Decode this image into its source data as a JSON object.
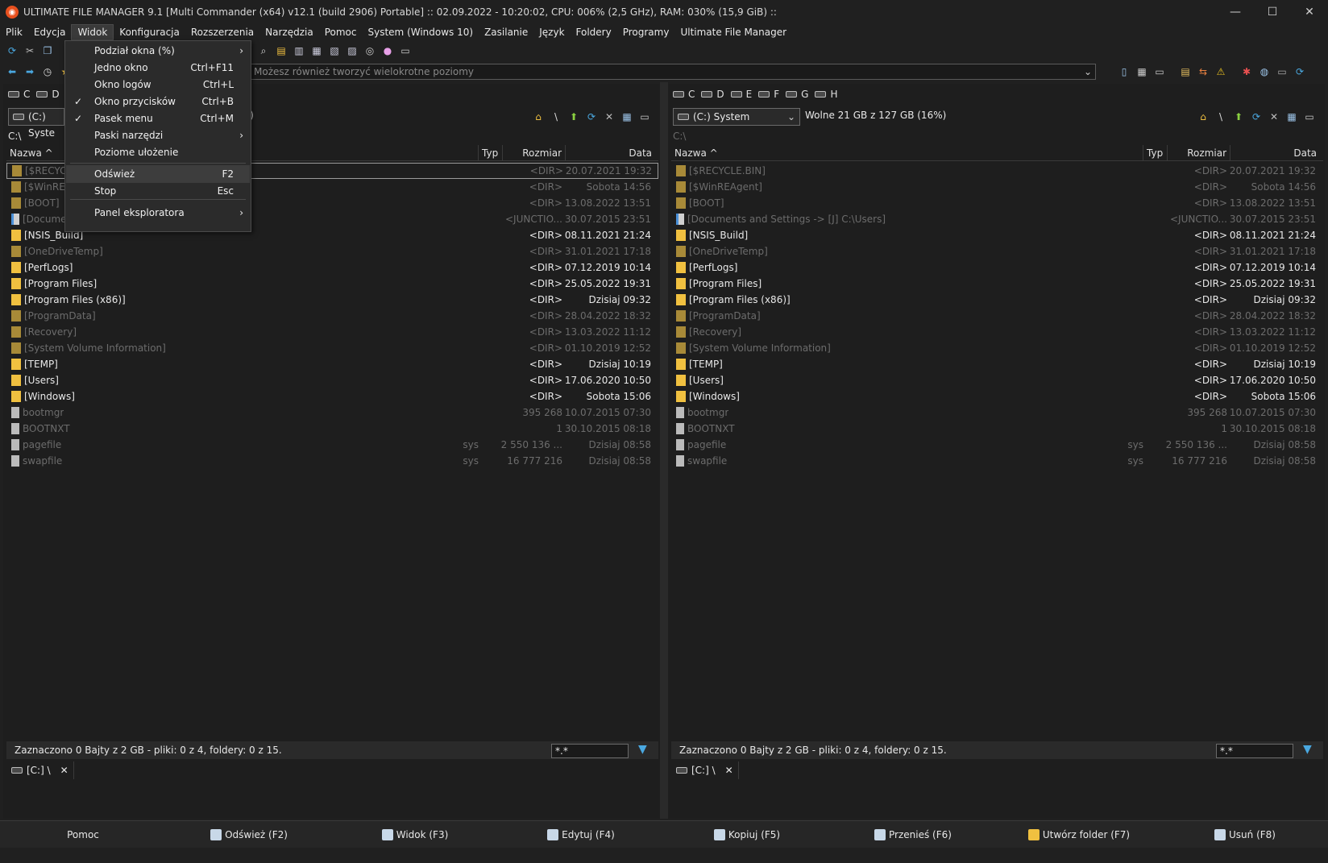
{
  "window": {
    "title": "ULTIMATE FILE MANAGER 9.1 [Multi Commander (x64)  v12.1 (build 2906) Portable] :: 02.09.2022 - 10:20:02, CPU: 006% (2,5 GHz), RAM: 030% (15,9 GiB) ::",
    "minimize": "—",
    "maximize": "☐",
    "close": "✕"
  },
  "menubar": [
    "Plik",
    "Edycja",
    "Widok",
    "Konfiguracja",
    "Rozszerzenia",
    "Narzędzia",
    "Pomoc",
    "System (Windows 10)",
    "Zasilanie",
    "Język",
    "Foldery",
    "Programy",
    "Ultimate File Manager"
  ],
  "navbar": {
    "placeholder": "Możesz również tworzyć wielokrotne poziomy",
    "dropdown_icon": "chevron-down-icon"
  },
  "view_menu": {
    "items": [
      {
        "label": "Podział okna (%)",
        "shortcut": "",
        "submenu": true,
        "checked": false
      },
      {
        "label": "Jedno okno",
        "shortcut": "Ctrl+F11",
        "submenu": false,
        "checked": false
      },
      {
        "label": "Okno logów",
        "shortcut": "Ctrl+L",
        "submenu": false,
        "checked": false
      },
      {
        "label": "Okno przycisków",
        "shortcut": "Ctrl+B",
        "submenu": false,
        "checked": true
      },
      {
        "label": "Pasek menu",
        "shortcut": "Ctrl+M",
        "submenu": false,
        "checked": true
      },
      {
        "label": "Paski narzędzi",
        "shortcut": "",
        "submenu": true,
        "checked": false
      },
      {
        "label": "Poziome ułożenie",
        "shortcut": "",
        "submenu": false,
        "checked": false
      },
      {
        "label": "Odśwież",
        "shortcut": "F2",
        "submenu": false,
        "checked": false
      },
      {
        "label": "Stop",
        "shortcut": "Esc",
        "submenu": false,
        "checked": false
      },
      {
        "label": "Panel eksploratora",
        "shortcut": "",
        "submenu": true,
        "checked": false
      }
    ],
    "check_glyph": "✓",
    "arrow_glyph": "›"
  },
  "left_panel": {
    "drives": [
      "C",
      "D"
    ],
    "drive_select": "(C:) Syste",
    "free_suffix": "s)",
    "path": "C:\\",
    "columns": {
      "name": "Nazwa ^",
      "type": "Typ",
      "size": "Rozmiar",
      "date": "Data"
    },
    "status": "Zaznaczono 0 Bajty z 2 GB - pliki: 0 z 4, foldery: 0 z 15.",
    "filter": "*.*",
    "tab": "[C:] \\",
    "tab_close": "✕"
  },
  "right_panel": {
    "drives": [
      "C",
      "D",
      "E",
      "F",
      "G",
      "H"
    ],
    "drive_select": "(C:) System",
    "free": "Wolne 21 GB z 127 GB (16%)",
    "path": "C:\\",
    "columns": {
      "name": "Nazwa ^",
      "type": "Typ",
      "size": "Rozmiar",
      "date": "Data"
    },
    "status": "Zaznaczono 0 Bajty z 2 GB - pliki: 0 z 4, foldery: 0 z 15.",
    "filter": "*.*",
    "tab": "[C:] \\",
    "tab_close": "✕"
  },
  "files": [
    {
      "name": "[$RECYCLE.BIN]",
      "type": "",
      "size": "<DIR>",
      "date": "20.07.2021 19:32",
      "kind": "dir",
      "hidden": true
    },
    {
      "name": "[$WinREAgent]",
      "type": "",
      "size": "<DIR>",
      "date": "Sobota 14:56",
      "kind": "dir",
      "hidden": true
    },
    {
      "name": "[BOOT]",
      "type": "",
      "size": "<DIR>",
      "date": "13.08.2022 13:51",
      "kind": "dir",
      "hidden": true
    },
    {
      "name": "[Documents and Settings ->  [J] C:\\Users]",
      "type": "",
      "size": "<JUNCTIO...",
      "date": "30.07.2015 23:51",
      "kind": "junction",
      "hidden": true
    },
    {
      "name": "[NSIS_Build]",
      "type": "",
      "size": "<DIR>",
      "date": "08.11.2021 21:24",
      "kind": "dir",
      "hidden": false
    },
    {
      "name": "[OneDriveTemp]",
      "type": "",
      "size": "<DIR>",
      "date": "31.01.2021 17:18",
      "kind": "dir",
      "hidden": true
    },
    {
      "name": "[PerfLogs]",
      "type": "",
      "size": "<DIR>",
      "date": "07.12.2019 10:14",
      "kind": "dir",
      "hidden": false
    },
    {
      "name": "[Program Files]",
      "type": "",
      "size": "<DIR>",
      "date": "25.05.2022 19:31",
      "kind": "dir",
      "hidden": false
    },
    {
      "name": "[Program Files (x86)]",
      "type": "",
      "size": "<DIR>",
      "date": "Dzisiaj 09:32",
      "kind": "dir",
      "hidden": false
    },
    {
      "name": "[ProgramData]",
      "type": "",
      "size": "<DIR>",
      "date": "28.04.2022 18:32",
      "kind": "dir",
      "hidden": true
    },
    {
      "name": "[Recovery]",
      "type": "",
      "size": "<DIR>",
      "date": "13.03.2022 11:12",
      "kind": "dir",
      "hidden": true
    },
    {
      "name": "[System Volume Information]",
      "type": "",
      "size": "<DIR>",
      "date": "01.10.2019 12:52",
      "kind": "dir",
      "hidden": true
    },
    {
      "name": "[TEMP]",
      "type": "",
      "size": "<DIR>",
      "date": "Dzisiaj 10:19",
      "kind": "dir",
      "hidden": false
    },
    {
      "name": "[Users]",
      "type": "",
      "size": "<DIR>",
      "date": "17.06.2020 10:50",
      "kind": "dir",
      "hidden": false
    },
    {
      "name": "[Windows]",
      "type": "",
      "size": "<DIR>",
      "date": "Sobota 15:06",
      "kind": "dir",
      "hidden": false
    },
    {
      "name": "bootmgr",
      "type": "",
      "size": "395 268",
      "date": "10.07.2015 07:30",
      "kind": "file",
      "hidden": true
    },
    {
      "name": "BOOTNXT",
      "type": "",
      "size": "1",
      "date": "30.10.2015 08:18",
      "kind": "file",
      "hidden": true
    },
    {
      "name": "pagefile",
      "type": "sys",
      "size": "2 550 136 ...",
      "date": "Dzisiaj 08:58",
      "kind": "file",
      "hidden": true
    },
    {
      "name": "swapfile",
      "type": "sys",
      "size": "16 777 216",
      "date": "Dzisiaj 08:58",
      "kind": "file",
      "hidden": true
    }
  ],
  "left_visible_names": [
    "[$RECYCL",
    "[$WinREA",
    "[BOOT]",
    "[Docume",
    "[NSIS_Build]",
    "[OneDriveTemp]",
    "[PerfLogs]",
    "[Program Files]",
    "[Program Files (x86)]",
    "[ProgramData]",
    "[Recovery]",
    "[System Volume Information]",
    "[TEMP]",
    "[Users]",
    "[Windows]",
    "bootmgr",
    "BOOTNXT",
    "pagefile",
    "swapfile"
  ],
  "fkeys": [
    "Pomoc",
    "Odśwież (F2)",
    "Widok (F3)",
    "Edytuj (F4)",
    "Kopiuj (F5)",
    "Przenieś (F6)",
    "Utwórz folder (F7)",
    "Usuń (F8)"
  ],
  "colors": {
    "folder": "#f0c040",
    "hidden_text": "#6c6c6c",
    "accent": "#4aa8e0",
    "app_icon": "#e8501e"
  }
}
